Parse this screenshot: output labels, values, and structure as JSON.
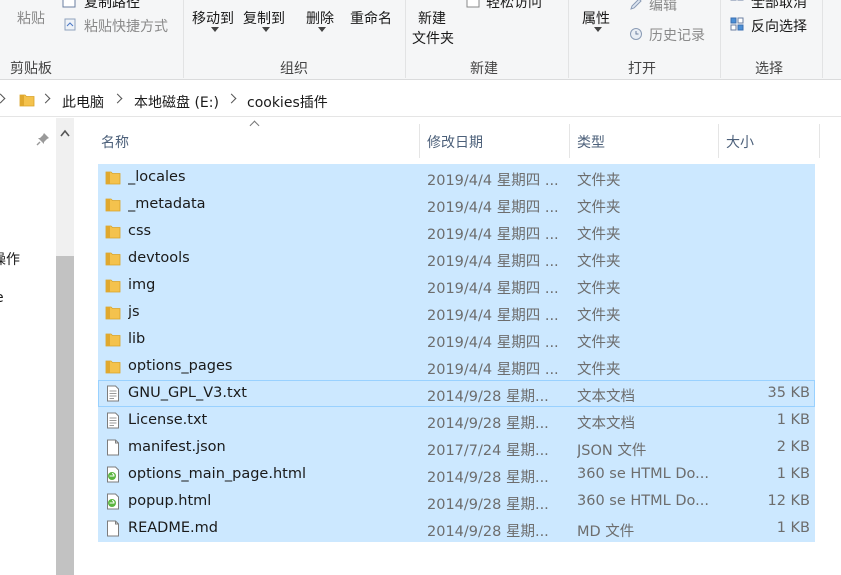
{
  "ribbon": {
    "clipboard": {
      "paste_label": "粘贴",
      "copy_path_label": "复制路径",
      "paste_shortcut_label": "粘贴快捷方式",
      "group_label": "剪贴板"
    },
    "organize": {
      "move_to_label": "移动到",
      "copy_to_label": "复制到",
      "delete_label": "删除",
      "rename_label": "重命名",
      "group_label": "组织"
    },
    "new": {
      "new_folder_line1": "新建",
      "new_folder_line2": "文件夹",
      "easy_access_label": "轻松访问",
      "group_label": "新建"
    },
    "open": {
      "properties_label": "属性",
      "edit_label": "编辑",
      "history_label": "历史记录",
      "group_label": "打开"
    },
    "select": {
      "select_none_label": "全部取消",
      "invert_selection_label": "反向选择",
      "group_label": "选择"
    }
  },
  "address": {
    "crumbs": [
      "此电脑",
      "本地磁盘 (E:)",
      "cookies插件"
    ]
  },
  "nav": {
    "partial_items": [
      "操作",
      "e"
    ]
  },
  "columns": {
    "name": "名称",
    "date": "修改日期",
    "type": "类型",
    "size": "大小"
  },
  "files": [
    {
      "name": "_locales",
      "date": "2019/4/4 星期四 ...",
      "type": "文件夹",
      "size": "",
      "icon": "folder-icon"
    },
    {
      "name": "_metadata",
      "date": "2019/4/4 星期四 ...",
      "type": "文件夹",
      "size": "",
      "icon": "folder-icon"
    },
    {
      "name": "css",
      "date": "2019/4/4 星期四 ...",
      "type": "文件夹",
      "size": "",
      "icon": "folder-icon"
    },
    {
      "name": "devtools",
      "date": "2019/4/4 星期四 ...",
      "type": "文件夹",
      "size": "",
      "icon": "folder-icon"
    },
    {
      "name": "img",
      "date": "2019/4/4 星期四 ...",
      "type": "文件夹",
      "size": "",
      "icon": "folder-icon"
    },
    {
      "name": "js",
      "date": "2019/4/4 星期四 ...",
      "type": "文件夹",
      "size": "",
      "icon": "folder-icon"
    },
    {
      "name": "lib",
      "date": "2019/4/4 星期四 ...",
      "type": "文件夹",
      "size": "",
      "icon": "folder-icon"
    },
    {
      "name": "options_pages",
      "date": "2019/4/4 星期四 ...",
      "type": "文件夹",
      "size": "",
      "icon": "folder-icon"
    },
    {
      "name": "GNU_GPL_V3.txt",
      "date": "2014/9/28 星期...",
      "type": "文本文档",
      "size": "35 KB",
      "icon": "text-file-icon"
    },
    {
      "name": "License.txt",
      "date": "2014/9/28 星期...",
      "type": "文本文档",
      "size": "1 KB",
      "icon": "text-file-icon"
    },
    {
      "name": "manifest.json",
      "date": "2017/7/24 星期...",
      "type": "JSON 文件",
      "size": "2 KB",
      "icon": "blank-file-icon"
    },
    {
      "name": "options_main_page.html",
      "date": "2014/9/28 星期...",
      "type": "360 se HTML Do...",
      "size": "1 KB",
      "icon": "html-file-icon"
    },
    {
      "name": "popup.html",
      "date": "2014/9/28 星期...",
      "type": "360 se HTML Do...",
      "size": "12 KB",
      "icon": "html-file-icon"
    },
    {
      "name": "README.md",
      "date": "2014/9/28 星期...",
      "type": "MD 文件",
      "size": "1 KB",
      "icon": "blank-file-icon"
    }
  ],
  "colors": {
    "selection": "#cce8ff",
    "selection_border": "#99d1ff",
    "folder_yellow": "#f4c24d",
    "header_text": "#4c607a"
  }
}
